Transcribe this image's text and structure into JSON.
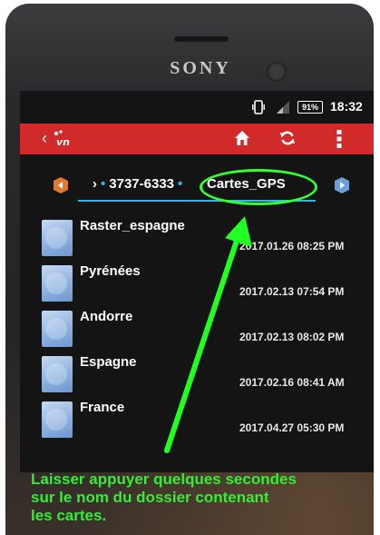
{
  "device": {
    "brand": "SONY"
  },
  "status_bar": {
    "battery_label": "91%",
    "time": "18:32",
    "vibrate_icon": "vibrate-icon",
    "signal_icon": "signal-icon"
  },
  "action_bar": {
    "color": "#d22a2a",
    "back_symbol": "‹",
    "logo_text": "vn",
    "icons": [
      "home-icon",
      "refresh-icon",
      "overflow-menu-icon"
    ]
  },
  "path_bar": {
    "segment_1": "3737-6333",
    "segment_current": "Cartes_GPS",
    "accent": "#33b5e5"
  },
  "files": [
    {
      "name": "Raster_espagne",
      "date": "2017.01.26 08:25 PM"
    },
    {
      "name": "Pyrénées",
      "date": "2017.02.13 07:54 PM"
    },
    {
      "name": "Andorre",
      "date": "2017.02.13 08:02 PM"
    },
    {
      "name": "Espagne",
      "date": "2017.02.16 08:41 AM"
    },
    {
      "name": "France",
      "date": "2017.04.27 05:30 PM"
    }
  ],
  "annotation": {
    "color": "#33ff33",
    "line_1": "Laisser appuyer quelques secondes",
    "line_2": "sur le nom du dossier contenant",
    "line_3": "les cartes."
  }
}
